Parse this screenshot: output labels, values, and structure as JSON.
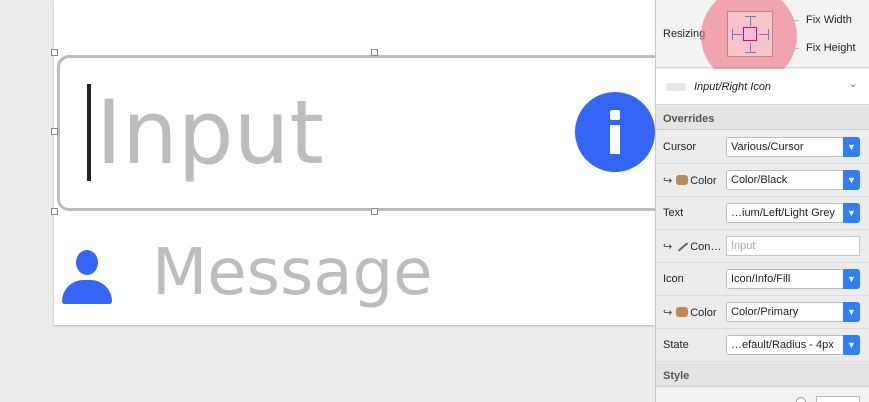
{
  "canvas": {
    "input_placeholder": "Input",
    "message_text": "Message",
    "accent_color": "#3366f5"
  },
  "inspector": {
    "resizing": {
      "label": "Resizing",
      "fix_width": "Fix Width",
      "fix_height": "Fix Height"
    },
    "symbol": {
      "name": "Input/Right Icon"
    },
    "overrides": {
      "header": "Overrides",
      "rows": [
        {
          "label": "Cursor",
          "value": "Various/Cursor"
        },
        {
          "label": "Color",
          "value": "Color/Black"
        },
        {
          "label": "Text",
          "value": "…ium/Left/Light Grey"
        },
        {
          "label": "Con…",
          "value": "",
          "placeholder": "Input"
        },
        {
          "label": "Icon",
          "value": "Icon/Info/Fill"
        },
        {
          "label": "Color",
          "value": "Color/Primary"
        },
        {
          "label": "State",
          "value": "…efault/Radius - 4px"
        }
      ]
    },
    "style": {
      "header": "Style"
    }
  }
}
